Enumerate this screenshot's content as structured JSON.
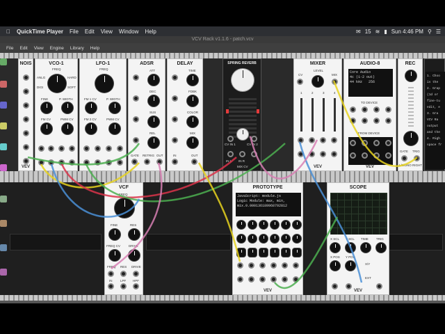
{
  "menubar": {
    "apple": "",
    "app": "QuickTime Player",
    "items": [
      "File",
      "Edit",
      "View",
      "Window",
      "Help"
    ],
    "status": {
      "badge": "15",
      "clock": "Sun 4:46 PM"
    }
  },
  "window": {
    "title": "VCV Rack v1.1.6 - patch.vcv"
  },
  "appmenu": {
    "items": [
      "File",
      "Edit",
      "View",
      "Engine",
      "Library",
      "Help"
    ]
  },
  "modules": {
    "nois": {
      "name": "NOIS",
      "labels": [
        "WHT",
        "PINK",
        "RED",
        "VIOL",
        "BLUE",
        "GRAY",
        "BLCK"
      ],
      "brand": "VEV"
    },
    "vco": {
      "name": "VCO-1",
      "freq": "FREQ",
      "analog": "ANLG",
      "digital": "DIGI",
      "hard": "HARD",
      "soft": "SOFT",
      "fine": "FINE",
      "pw": "P. WIDTH",
      "fmcv": "FM CV",
      "pwmcv": "PWM CV",
      "ports": [
        "V/OCT",
        "FM",
        "SYNC",
        "PWM",
        "SIN",
        "TRI",
        "SAW",
        "SQR"
      ]
    },
    "lfo": {
      "name": "LFO-1",
      "freq": "FREQ",
      "fm1": "FM 1 CV",
      "pw": "P. WIDTH",
      "fm2": "FM 2 CV",
      "pwm": "PWM CV",
      "ports": [
        "FM 1",
        "FM 2",
        "RESET",
        "PWM",
        "SIN",
        "TRI",
        "SAW",
        "SQR"
      ]
    },
    "adsr": {
      "name": "ADSR",
      "knobs": [
        "ATT",
        "DEC",
        "SUS",
        "REL"
      ],
      "ports": [
        "GATE",
        "RETRIG",
        "OUT"
      ]
    },
    "delay": {
      "name": "DELAY",
      "knobs": [
        "TIME",
        "FDBK",
        "COLOR",
        "MIX"
      ],
      "ports": [
        "IN",
        "OUT"
      ]
    },
    "spring": {
      "name": "SPRING REVERB",
      "io": [
        "CV IN 1",
        "CV IN 2",
        "IN L",
        "IN R",
        "MIX",
        "MIX CV"
      ]
    },
    "mixer": {
      "name": "MIXER",
      "level": "LEVEL",
      "cv": "CV",
      "mix": "MIX",
      "channels": [
        "1",
        "2",
        "3",
        "4"
      ],
      "ports": [
        "IN 1",
        "IN 2",
        "IN 3",
        "IN 4",
        "CV 1",
        "CV 2",
        "CV 3",
        "CV 4"
      ],
      "brand": "VEV"
    },
    "audio": {
      "name": "AUDIO-8",
      "driver": "Core Audio",
      "device": "4c (1-2 out)",
      "rate": "44 kHz",
      "block": "256",
      "todevice": "TO DEVICE",
      "fromdevice": "FROM DEVICE",
      "brand": "VEV"
    },
    "rec": {
      "name": "REC",
      "ports": [
        "GATE",
        "TRIG",
        "L/MONO",
        "RIGHT"
      ],
      "help": [
        "1. Choo",
        "is the",
        "2. Grap",
        "(1d or",
        "fine-tu",
        "edit, e",
        "3. Gra",
        "VCV Ra",
        "output",
        "and the",
        "4. Righ",
        "space fr"
      ]
    },
    "vcf": {
      "name": "VCF",
      "freq": "FREQ",
      "fine": "FINE",
      "res": "RES",
      "freqcv": "FREQ CV",
      "drive": "DRIVE",
      "ports": [
        "FREQ",
        "RES",
        "DRIVE",
        "IN",
        "LPF",
        "HPF"
      ],
      "brand": "VEV"
    },
    "prototype": {
      "name": "PROTOTYPE",
      "console": [
        "JavaScript: module.js",
        "Logic Module: max, min,",
        "mix.0.000136189968792812"
      ],
      "brand": "VEV"
    },
    "scope": {
      "name": "SCOPE",
      "knobs": [
        "X SCL",
        "Y SCL",
        "TIME",
        "TRIG",
        "X POS",
        "Y POS",
        "X/Y",
        "EXT"
      ],
      "ports": [
        "X IN",
        "Y IN",
        "TRIG"
      ],
      "brand": "VEV"
    }
  },
  "colors": {
    "accent": "#e63a3a",
    "cable_yellow": "#e6d21e",
    "cable_green": "#4caf50",
    "cable_blue": "#4a8fd6",
    "cable_red": "#d9344a",
    "cable_pink": "#d77fb3"
  }
}
